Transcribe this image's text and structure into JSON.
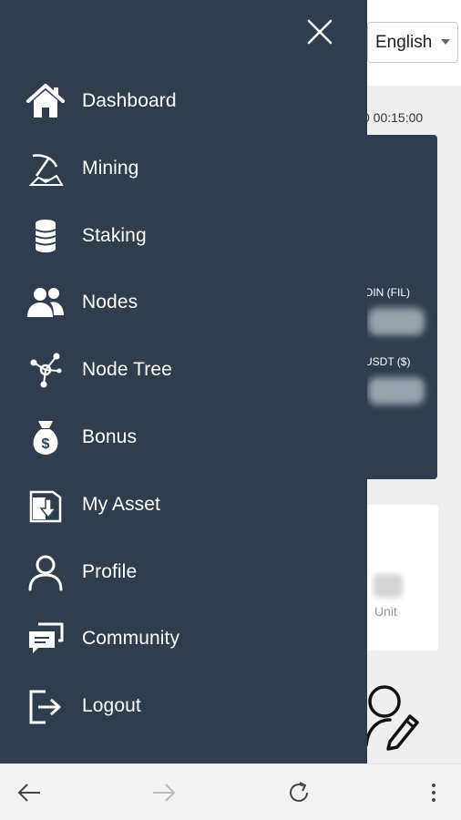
{
  "language_select": {
    "value": "English"
  },
  "background": {
    "datetime_text": "0 00:15:00",
    "fil_label": "OIN (FIL)",
    "usdt_label": "USDT ($)",
    "unit_label": "Unit"
  },
  "drawer": {
    "menu": [
      {
        "label": "Dashboard",
        "icon": "home-icon"
      },
      {
        "label": "Mining",
        "icon": "pickaxe-icon"
      },
      {
        "label": "Staking",
        "icon": "coin-stack-icon"
      },
      {
        "label": "Nodes",
        "icon": "users-icon"
      },
      {
        "label": "Node Tree",
        "icon": "network-icon"
      },
      {
        "label": "Bonus",
        "icon": "money-bag-icon"
      },
      {
        "label": "My Asset",
        "icon": "asset-download-icon"
      },
      {
        "label": "Profile",
        "icon": "user-icon"
      },
      {
        "label": "Community",
        "icon": "chat-icon"
      },
      {
        "label": "Logout",
        "icon": "logout-icon"
      }
    ]
  },
  "browser_bar": {
    "back_icon": "back-arrow-icon",
    "forward_icon": "forward-arrow-icon",
    "reload_icon": "reload-icon",
    "menu_icon": "more-vertical-icon"
  },
  "colors": {
    "drawer_bg": "#2f3d4e",
    "page_bg": "#efefef",
    "text_on_drawer": "#ffffff"
  }
}
